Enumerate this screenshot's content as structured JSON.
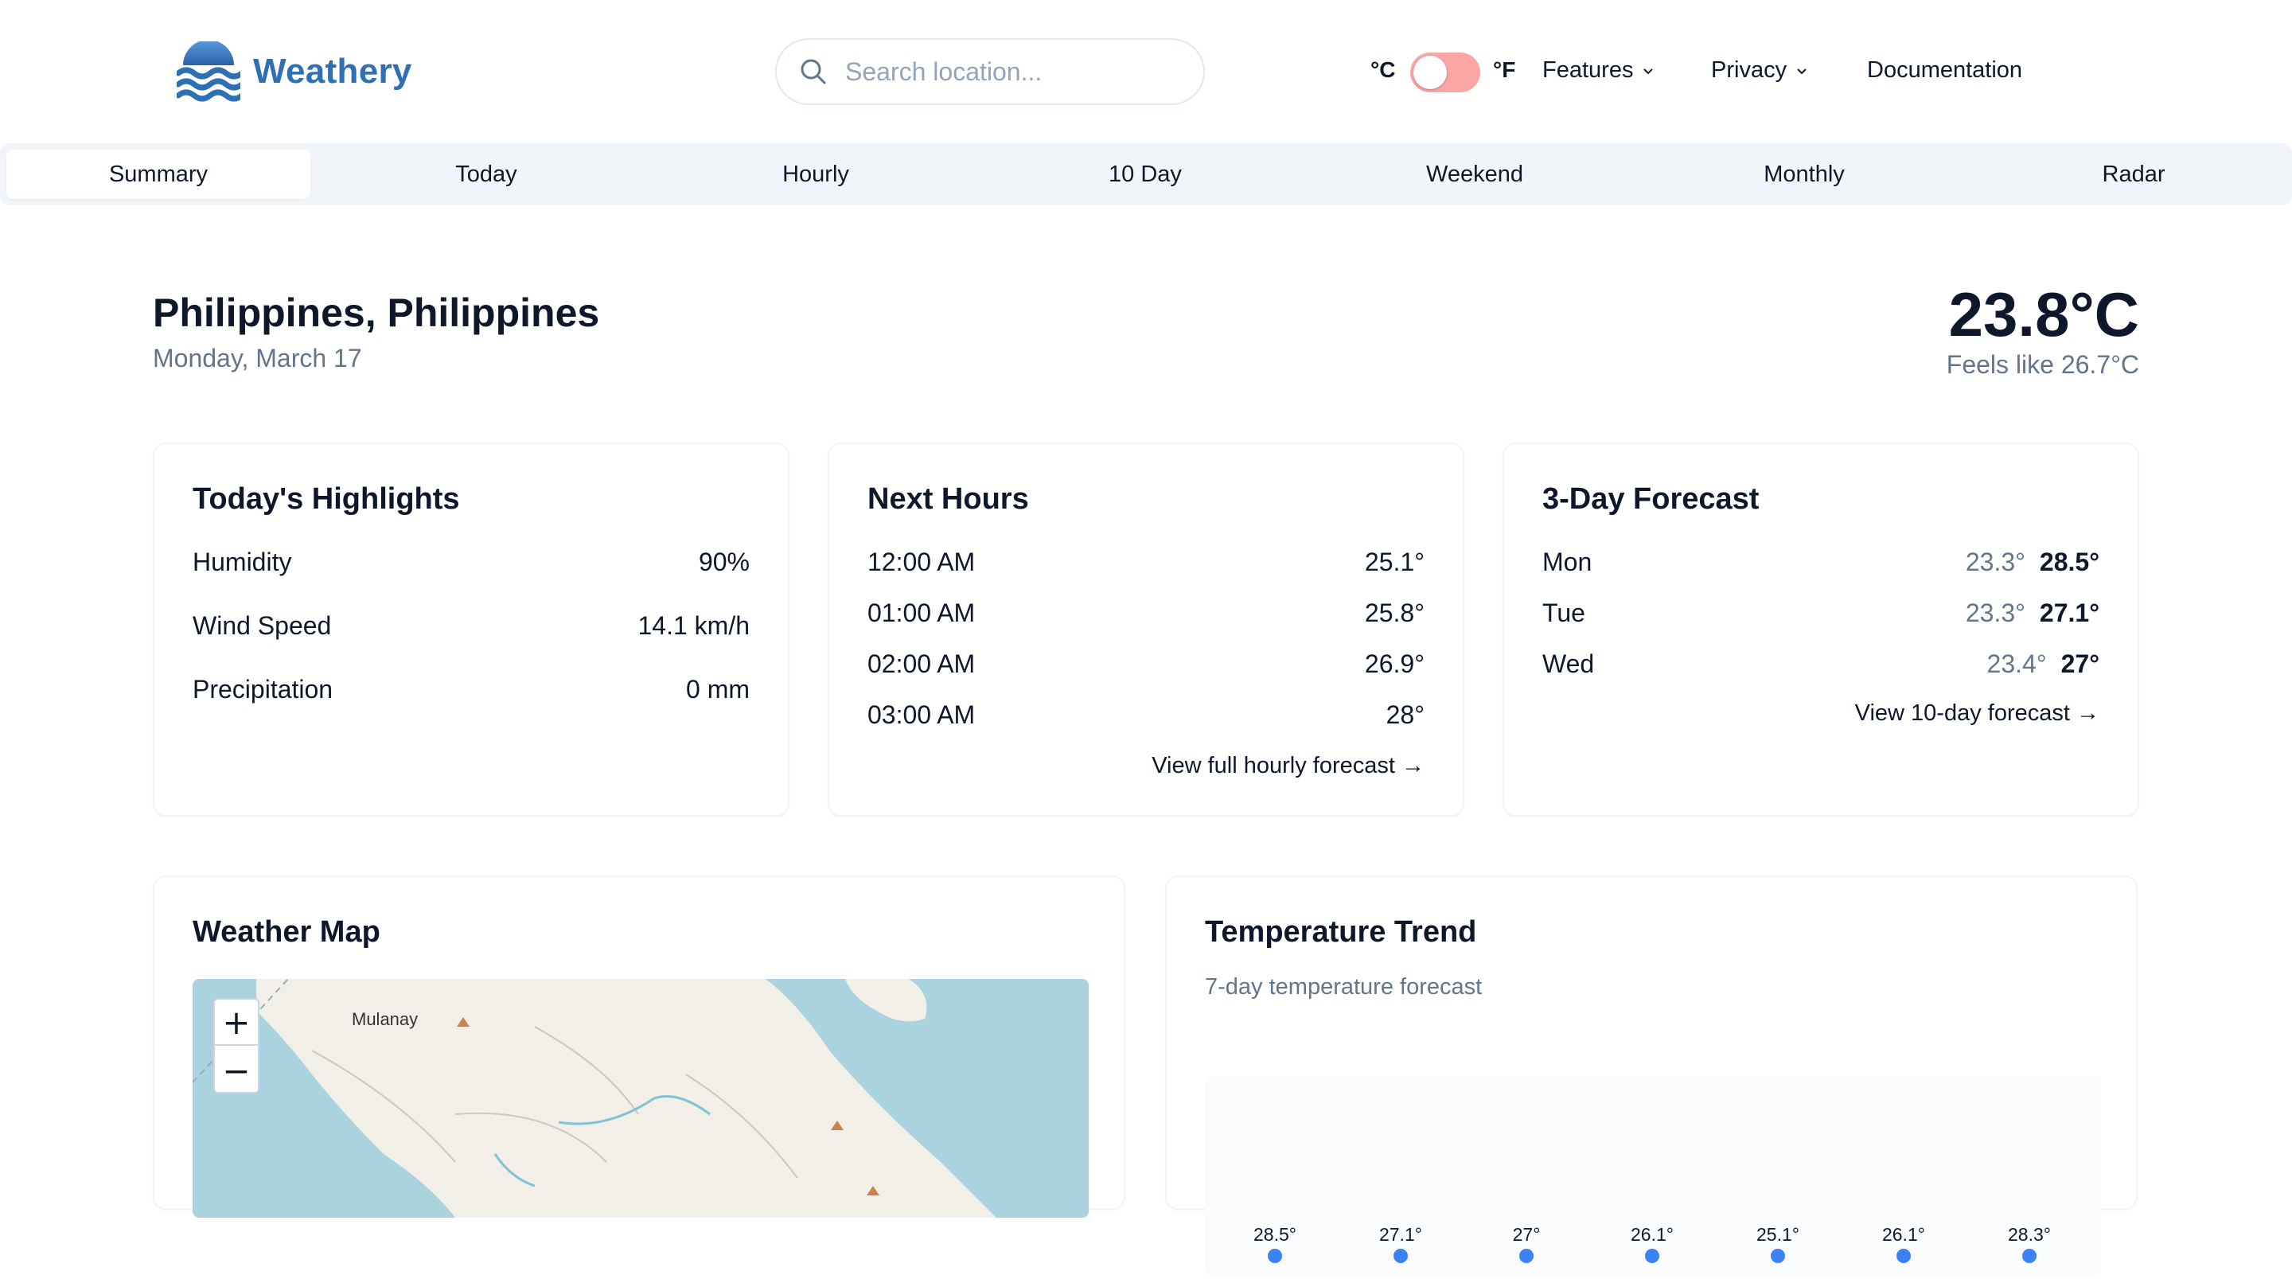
{
  "brand": {
    "name": "Weathery"
  },
  "search": {
    "placeholder": "Search location..."
  },
  "units": {
    "celsius": "°C",
    "fahrenheit": "°F"
  },
  "nav": {
    "features": "Features",
    "privacy": "Privacy",
    "documentation": "Documentation"
  },
  "tabs": [
    {
      "label": "Summary",
      "active": true
    },
    {
      "label": "Today"
    },
    {
      "label": "Hourly"
    },
    {
      "label": "10 Day"
    },
    {
      "label": "Weekend"
    },
    {
      "label": "Monthly"
    },
    {
      "label": "Radar"
    }
  ],
  "location": {
    "name": "Philippines, Philippines",
    "date": "Monday, March 17"
  },
  "current": {
    "temp": "23.8°C",
    "feels_like": "Feels like 26.7°C"
  },
  "highlights": {
    "title": "Today's Highlights",
    "rows": [
      {
        "label": "Humidity",
        "value": "90%"
      },
      {
        "label": "Wind Speed",
        "value": "14.1 km/h"
      },
      {
        "label": "Precipitation",
        "value": "0 mm"
      }
    ]
  },
  "next_hours": {
    "title": "Next Hours",
    "rows": [
      {
        "time": "12:00 AM",
        "temp": "25.1°"
      },
      {
        "time": "01:00 AM",
        "temp": "25.8°"
      },
      {
        "time": "02:00 AM",
        "temp": "26.9°"
      },
      {
        "time": "03:00 AM",
        "temp": "28°"
      }
    ],
    "link": "View full hourly forecast →"
  },
  "forecast3": {
    "title": "3-Day Forecast",
    "rows": [
      {
        "day": "Mon",
        "lo": "23.3°",
        "hi": "28.5°"
      },
      {
        "day": "Tue",
        "lo": "23.3°",
        "hi": "27.1°"
      },
      {
        "day": "Wed",
        "lo": "23.4°",
        "hi": "27°"
      }
    ],
    "link": "View 10-day forecast →"
  },
  "map": {
    "title": "Weather Map",
    "place_label": "Mulanay",
    "zoom_in": "+",
    "zoom_out": "−"
  },
  "trend": {
    "title": "Temperature Trend",
    "subtitle": "7-day temperature forecast",
    "labels": [
      "28.5°",
      "27.1°",
      "27°",
      "26.1°",
      "25.1°",
      "26.1°",
      "28.3°"
    ]
  },
  "colors": {
    "brand": "#2f6fb4",
    "toggle": "#fca5a5",
    "point": "#3b82f6"
  }
}
